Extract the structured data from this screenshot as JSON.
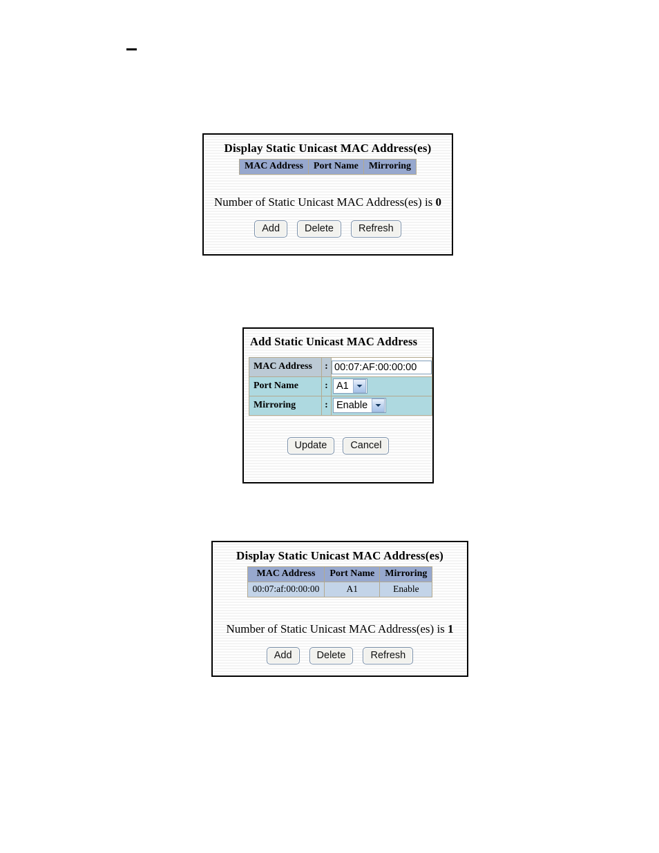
{
  "page": {
    "dash_mark": "—"
  },
  "panel_display_empty": {
    "title": "Display Static Unicast MAC Address(es)",
    "columns": [
      "MAC Address",
      "Port Name",
      "Mirroring"
    ],
    "rows": [],
    "count_prefix": "Number of Static Unicast MAC Address(es) is ",
    "count_value": "0",
    "buttons": {
      "add": "Add",
      "delete": "Delete",
      "refresh": "Refresh"
    }
  },
  "panel_add_form": {
    "title": "Add Static Unicast MAC Address",
    "colon": ":",
    "fields": {
      "mac_address": {
        "label": "MAC Address",
        "value": "00:07:AF:00:00:00"
      },
      "port_name": {
        "label": "Port Name",
        "value": "A1"
      },
      "mirroring": {
        "label": "Mirroring",
        "value": "Enable"
      }
    },
    "buttons": {
      "update": "Update",
      "cancel": "Cancel"
    }
  },
  "panel_display_one": {
    "title": "Display Static Unicast MAC Address(es)",
    "columns": [
      "MAC Address",
      "Port Name",
      "Mirroring"
    ],
    "rows": [
      {
        "mac_address": "00:07:af:00:00:00",
        "port_name": "A1",
        "mirroring": "Enable"
      }
    ],
    "count_prefix": "Number of Static Unicast MAC Address(es) is ",
    "count_value": "1",
    "buttons": {
      "add": "Add",
      "delete": "Delete",
      "refresh": "Refresh"
    }
  },
  "colors": {
    "table_header_bg": "#97a8ce",
    "table_row_bg": "#c3d4e8",
    "form_label_bg": "#bccad5",
    "form_cyan_bg": "#aedae0",
    "panel_border": "#000000",
    "button_bg": "#f2f2ee",
    "button_border": "#7b90a8"
  }
}
